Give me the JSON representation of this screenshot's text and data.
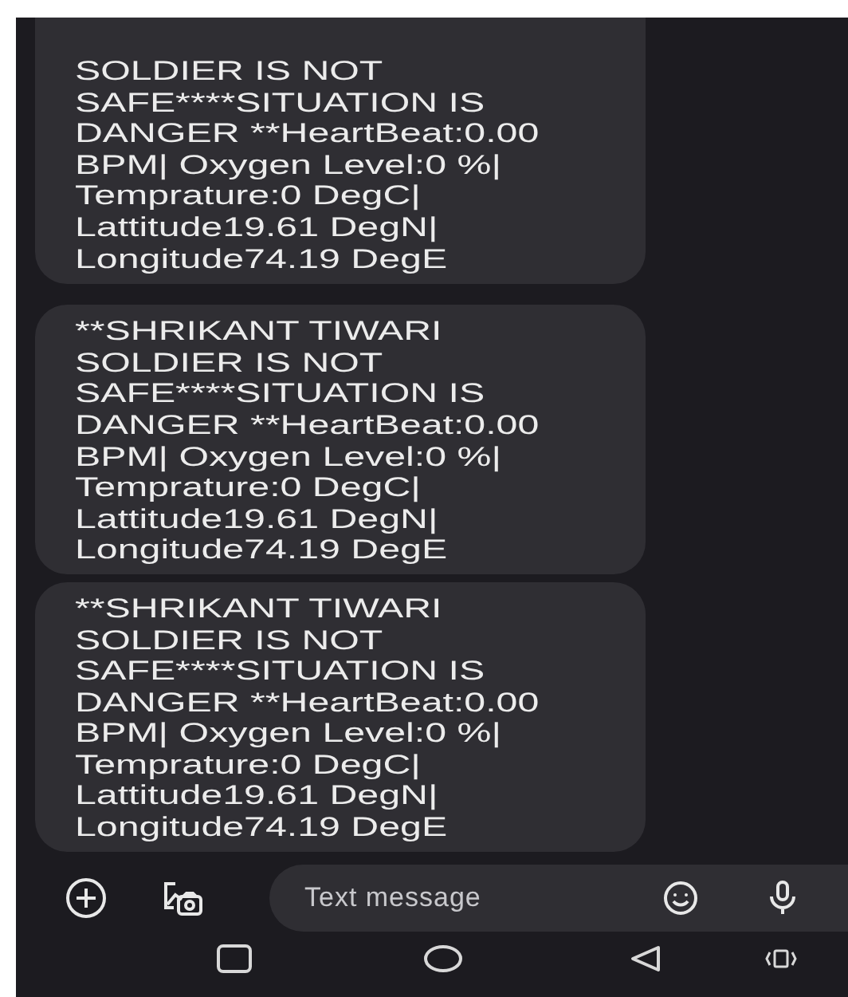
{
  "messages": [
    {
      "text": "SOLDIER IS NOT SAFE****SITUATION IS DANGER **HeartBeat:0.00 BPM| Oxygen Level:0 %| Temprature:0 DegC| Lattitude19.61 DegN| Longitude74.19 DegE"
    },
    {
      "text": "**SHRIKANT TIWARI SOLDIER IS NOT SAFE****SITUATION IS DANGER **HeartBeat:0.00 BPM| Oxygen Level:0 %| Temprature:0 DegC| Lattitude19.61 DegN| Longitude74.19 DegE"
    },
    {
      "text": "**SHRIKANT TIWARI SOLDIER IS NOT SAFE****SITUATION IS DANGER **HeartBeat:0.00 BPM| Oxygen Level:0 %| Temprature:0 DegC| Lattitude19.61 DegN| Longitude74.19 DegE"
    }
  ],
  "composer": {
    "placeholder": "Text message"
  }
}
